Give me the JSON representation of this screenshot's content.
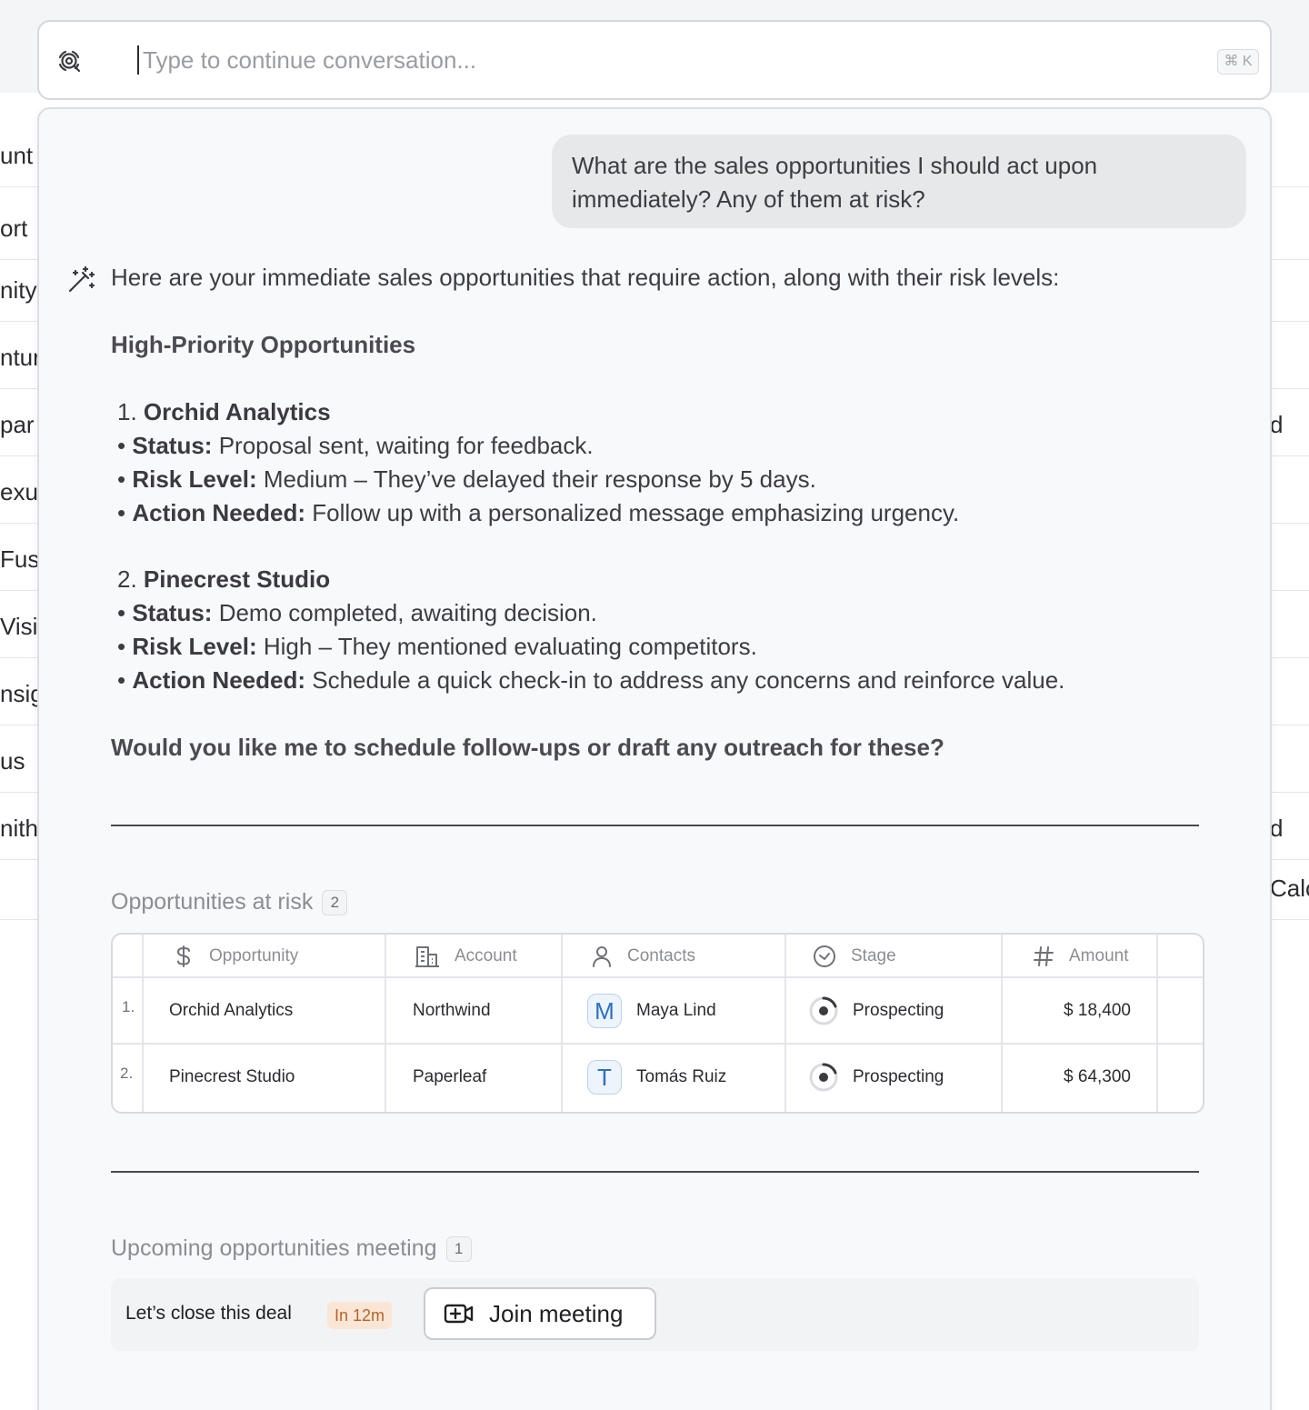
{
  "search": {
    "placeholder": "Type to continue conversation...",
    "shortcut": "⌘ K"
  },
  "background_fragments": {
    "left": [
      "unt",
      "ort",
      "nity",
      "ntur",
      "par",
      "exu",
      "Fus",
      "Visio",
      "nsig",
      "us",
      "nith"
    ],
    "right": [
      "d",
      "d",
      "Calc"
    ]
  },
  "conversation": {
    "user_message": "What are the sales opportunities I should act upon immediately? Any of them at risk?",
    "assistant": {
      "intro": "Here are your immediate sales opportunities that require action, along with their risk levels:",
      "heading": "High-Priority Opportunities",
      "items": [
        {
          "number": "1.",
          "name": "Orchid Analytics",
          "status_label": "Status:",
          "status": "Proposal sent, waiting for feedback.",
          "risk_label": "Risk Level:",
          "risk": "Medium – They’ve delayed their response by 5 days.",
          "action_label": "Action Needed:",
          "action": "Follow up with a personalized message emphasizing urgency."
        },
        {
          "number": "2.",
          "name": "Pinecrest Studio",
          "status_label": "Status:",
          "status": "Demo completed, awaiting decision.",
          "risk_label": "Risk Level:",
          "risk": "High – They mentioned evaluating competitors.",
          "action_label": "Action Needed:",
          "action": "Schedule a quick check-in to address any concerns and reinforce value."
        }
      ],
      "question": "Would you like me to schedule follow-ups or draft any outreach for these?"
    }
  },
  "at_risk": {
    "title": "Opportunities at risk",
    "count": "2",
    "columns": {
      "opportunity": "Opportunity",
      "account": "Account",
      "contacts": "Contacts",
      "stage": "Stage",
      "amount": "Amount"
    },
    "rows": [
      {
        "num": "1.",
        "opportunity": "Orchid Analytics",
        "account": "Northwind",
        "contact_initial": "M",
        "contact": "Maya Lind",
        "stage": "Prospecting",
        "amount": "$ 18,400"
      },
      {
        "num": "2.",
        "opportunity": "Pinecrest Studio",
        "account": "Paperleaf",
        "contact_initial": "T",
        "contact": "Tomás Ruiz",
        "stage": "Prospecting",
        "amount": "$ 64,300"
      }
    ]
  },
  "meeting": {
    "title": "Upcoming opportunities meeting",
    "count": "1",
    "name": "Let’s close this deal",
    "time": "In 12m",
    "join_label": "Join meeting"
  },
  "colors": {
    "accent_blue": "#2b6fc4",
    "badge_orange_bg": "#fbe6d6",
    "badge_orange_text": "#b4642a"
  }
}
